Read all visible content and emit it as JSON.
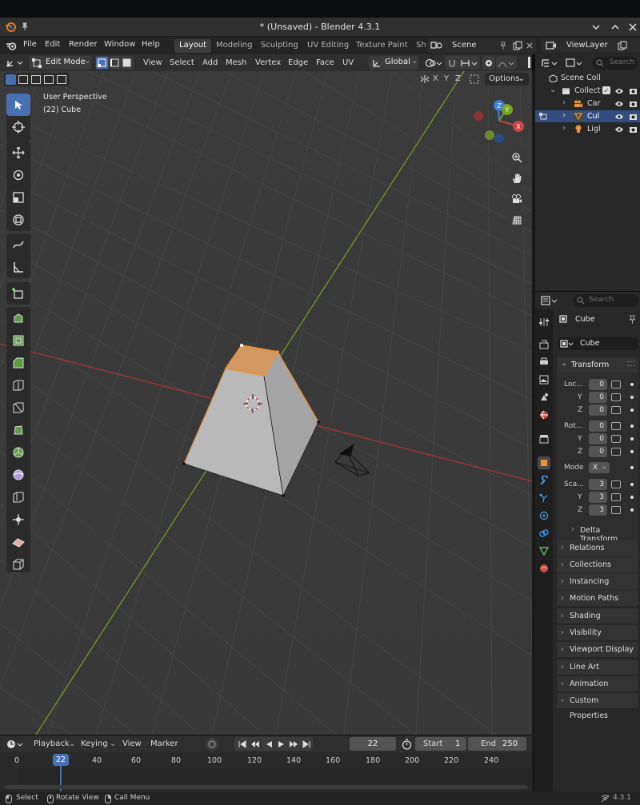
{
  "window": {
    "title": "* (Unsaved) - Blender 4.3.1"
  },
  "menu": [
    "File",
    "Edit",
    "Render",
    "Window",
    "Help"
  ],
  "workspaces": [
    "Layout",
    "Modeling",
    "Sculpting",
    "UV Editing",
    "Texture Paint",
    "Sh"
  ],
  "scene": {
    "label": "Scene",
    "view_layer": "ViewLayer"
  },
  "viewport_header": {
    "mode": "Edit Mode",
    "menus": [
      "View",
      "Select",
      "Add",
      "Mesh",
      "Vertex",
      "Edge",
      "Face",
      "UV"
    ],
    "orientation": "Global",
    "axes": [
      "X",
      "Y",
      "Z"
    ],
    "options": "Options"
  },
  "overlay": {
    "perspective": "User Perspective",
    "object": "(22) Cube"
  },
  "gizmo": {
    "z": "Z",
    "y": "Y",
    "x": "X"
  },
  "outliner": {
    "search_placeholder": "Search",
    "root": "Scene Coll",
    "collection": "Collect",
    "items": [
      "Car",
      "Cul",
      "Ligl"
    ]
  },
  "properties": {
    "search_placeholder": "Search",
    "object_name": "Cube",
    "data_name": "Cube",
    "transform_header": "Transform",
    "location_label": "Loc...",
    "rotation_label": "Rot...",
    "scale_label": "Sca...",
    "axis_y": "Y",
    "axis_z": "Z",
    "location": [
      "0",
      "0",
      "0"
    ],
    "rotation": [
      "0",
      "0",
      "0"
    ],
    "scale": [
      "3",
      "3",
      "3"
    ],
    "mode_label": "Mode",
    "mode_value": "X",
    "delta_transform": "Delta Transform",
    "panels": [
      "Relations",
      "Collections",
      "Instancing",
      "Motion Paths",
      "Shading",
      "Visibility",
      "Viewport Display",
      "Line Art",
      "Animation",
      "Custom Properties"
    ]
  },
  "timeline": {
    "menus": [
      "Playback",
      "Keying",
      "View",
      "Marker"
    ],
    "current_frame": "22",
    "start_label": "Start",
    "start": "1",
    "end_label": "End",
    "end": "250",
    "ruler": [
      "0",
      "22",
      "40",
      "60",
      "80",
      "100",
      "120",
      "140",
      "160",
      "180",
      "200",
      "220",
      "240"
    ]
  },
  "status": {
    "select": "Select",
    "rotate": "Rotate View",
    "call_menu": "Call Menu",
    "version": "4.3.1"
  },
  "colors": {
    "accent": "#4771b3",
    "selection": "#e8933a",
    "x_axis": "#c43a3a",
    "y_axis": "#76a320"
  }
}
